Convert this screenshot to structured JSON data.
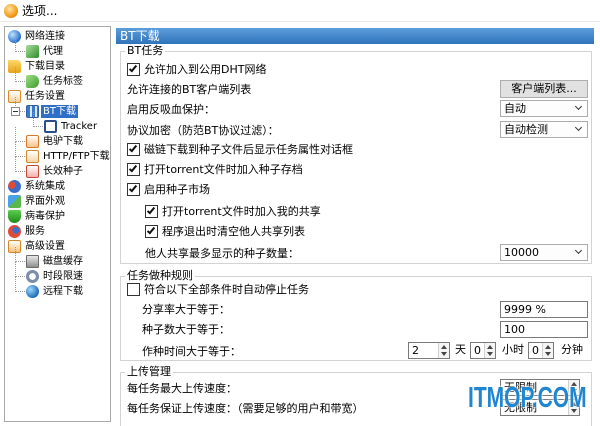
{
  "window": {
    "title": "选项..."
  },
  "tree": [
    {
      "label": "网络连接",
      "level": 0,
      "icon": "network-icon"
    },
    {
      "label": "代理",
      "level": 1,
      "icon": "proxy-icon"
    },
    {
      "label": "下载目录",
      "level": 0,
      "icon": "folder-icon"
    },
    {
      "label": "任务标签",
      "level": 1,
      "icon": "tag-icon"
    },
    {
      "label": "任务设置",
      "level": 0,
      "icon": "task-settings-icon"
    },
    {
      "label": "BT下载",
      "level": 1,
      "icon": "bt-icon",
      "selected": true,
      "expanded": true
    },
    {
      "label": "Tracker",
      "level": 2,
      "icon": "tracker-icon"
    },
    {
      "label": "电驴下载",
      "level": 1,
      "icon": "edonkey-icon"
    },
    {
      "label": "HTTP/FTP下载",
      "level": 1,
      "icon": "http-ftp-icon"
    },
    {
      "label": "长效种子",
      "level": 1,
      "icon": "seed-icon"
    },
    {
      "label": "系统集成",
      "level": 0,
      "icon": "system-integration-icon"
    },
    {
      "label": "界面外观",
      "level": 0,
      "icon": "appearance-icon"
    },
    {
      "label": "病毒保护",
      "level": 0,
      "icon": "shield-icon"
    },
    {
      "label": "服务",
      "level": 0,
      "icon": "service-icon"
    },
    {
      "label": "高级设置",
      "level": 0,
      "icon": "advanced-settings-icon"
    },
    {
      "label": "磁盘缓存",
      "level": 1,
      "icon": "disk-cache-icon"
    },
    {
      "label": "时段限速",
      "level": 1,
      "icon": "speed-limit-icon"
    },
    {
      "label": "远程下载",
      "level": 1,
      "icon": "remote-download-icon"
    }
  ],
  "panel": {
    "header": "BT下载",
    "bt_tasks": {
      "legend": "BT任务",
      "dht": {
        "label": "允许加入到公用DHT网络",
        "checked": true
      },
      "client_list": {
        "label": "允许连接的BT客户端列表",
        "button": "客户端列表..."
      },
      "anti_leech": {
        "label": "启用反吸血保护：",
        "value": "自动"
      },
      "encryption": {
        "label": "协议加密（防范BT协议过滤）：",
        "value": "自动检测"
      },
      "magnet_props": {
        "label": "磁链下载到种子文件后显示任务属性对话框",
        "checked": true
      },
      "torrent_archive": {
        "label": "打开torrent文件时加入种子存档",
        "checked": true
      },
      "seed_market": {
        "label": "启用种子市场",
        "checked": true
      },
      "add_share": {
        "label": "打开torrent文件时加入我的共享",
        "checked": true
      },
      "clear_share": {
        "label": "程序退出时清空他人共享列表",
        "checked": true
      },
      "max_seeds": {
        "label": "他人共享最多显示的种子数量：",
        "value": "10000"
      }
    },
    "seeding_rules": {
      "legend": "任务做种规则",
      "auto_stop": {
        "label": "符合以下全部条件时自动停止任务",
        "checked": false
      },
      "share_ratio": {
        "label": "分享率大于等于：",
        "value": "9999 %"
      },
      "seed_count": {
        "label": "种子数大于等于：",
        "value": "100"
      },
      "seed_time": {
        "label": "作种时间大于等于：",
        "days": "2",
        "days_unit": "天",
        "hours": "0",
        "hours_unit": "小时",
        "minutes": "0",
        "minutes_unit": "分钟"
      }
    },
    "upload": {
      "legend": "上传管理",
      "max_speed": {
        "label": "每任务最大上传速度：",
        "value": "无限制"
      },
      "guaranteed_speed": {
        "label": "每任务保证上传速度：（需要足够的用户和带宽）",
        "value": "无限制"
      }
    }
  },
  "watermark": "ITMOP.COM",
  "colors": {
    "header": "#2f73ba",
    "selected": "#2f6fc6",
    "watermark": "#1f86cf"
  }
}
